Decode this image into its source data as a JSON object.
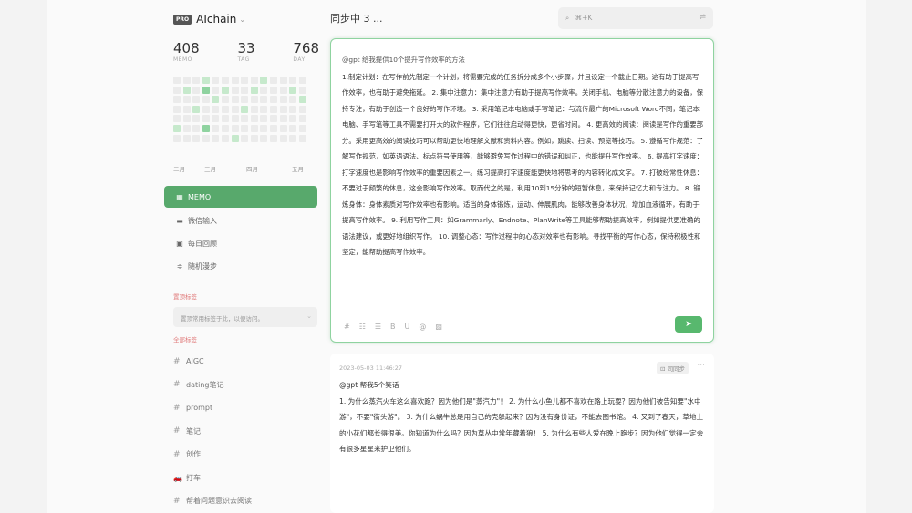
{
  "brand": {
    "badge": "PRO",
    "name": "AIchain"
  },
  "stats": [
    {
      "value": "408",
      "label": "MEMO"
    },
    {
      "value": "33",
      "label": "TAG"
    },
    {
      "value": "768",
      "label": "DAY"
    }
  ],
  "heatmap_levels": [
    0,
    0,
    0,
    1,
    0,
    0,
    0,
    0,
    0,
    1,
    0,
    0,
    0,
    0,
    0,
    1,
    0,
    2,
    0,
    1,
    0,
    0,
    1,
    0,
    0,
    0,
    1,
    0,
    0,
    0,
    0,
    0,
    1,
    0,
    0,
    0,
    0,
    0,
    0,
    0,
    0,
    1,
    0,
    0,
    1,
    0,
    0,
    0,
    0,
    1,
    0,
    0,
    0,
    0,
    0,
    0,
    0,
    0,
    0,
    0,
    0,
    0,
    0,
    0,
    0,
    0,
    0,
    0,
    0,
    0,
    1,
    0,
    0,
    2,
    0,
    0,
    0,
    0,
    0,
    0,
    0,
    0,
    0,
    0,
    0,
    0,
    0,
    0,
    0,
    0,
    1,
    0,
    0,
    0,
    0,
    0,
    0,
    0
  ],
  "months": [
    "二月",
    "三月",
    "四月",
    "五月"
  ],
  "nav": [
    {
      "icon": "grid-icon",
      "glyph": "▦",
      "label": "MEMO",
      "active": true
    },
    {
      "icon": "chat-icon",
      "glyph": "▬",
      "label": "微信输入",
      "active": false
    },
    {
      "icon": "calendar-icon",
      "glyph": "▣",
      "label": "每日回顾",
      "active": false
    },
    {
      "icon": "shuffle-icon",
      "glyph": "≑",
      "label": "随机漫步",
      "active": false
    }
  ],
  "pinned_label": "置顶标签",
  "pinned_placeholder": "置顶常用标签于此，以便访问。",
  "all_tags_label": "全部标签",
  "tags": [
    {
      "icon": "hash-icon",
      "glyph": "#",
      "label": "AIGC"
    },
    {
      "icon": "hash-icon",
      "glyph": "#",
      "label": "dating笔记"
    },
    {
      "icon": "hash-icon",
      "glyph": "#",
      "label": "prompt"
    },
    {
      "icon": "hash-icon",
      "glyph": "#",
      "label": "笔记"
    },
    {
      "icon": "hash-icon",
      "glyph": "#",
      "label": "创作"
    },
    {
      "icon": "car-icon",
      "glyph": "🚗",
      "label": "打车"
    },
    {
      "icon": "hash-icon",
      "glyph": "#",
      "label": "帮着问题意识去阅读"
    }
  ],
  "main": {
    "title": "同步中 3 ...",
    "search_placeholder": "⌘+K"
  },
  "editor": {
    "first_line": "@gpt 给我提供10个提升写作效率的方法",
    "body": "1.制定计划：在写作前先制定一个计划，将需要完成的任务拆分成多个小步骤，并且设定一个截止日期。这有助于提高写作效率，也有助于避免拖延。 2. 集中注意力：集中注意力有助于提高写作效率。关闭手机、电脑等分散注意力的设备，保持专注，有助于创造一个良好的写作环境。 3. 采用笔记本电脑或手写笔记：与流传最广的Microsoft Word不同，笔记本电脑、手写笔等工具不需要打开大的软件程序，它们往往启动得更快，更省时间。 4. 更高效的阅读：阅读是写作的重要部分。采用更高效的阅读技巧可以帮助更快地理解文献和资料内容。例如，跳读、扫读、预览等技巧。 5. 遵循写作规范：了解写作规范，如英语语法、标点符号使用等，能够避免写作过程中的错误和纠正，也能提升写作效率。 6. 提高打字速度：打字速度也是影响写作效率的重要因素之一。练习提高打字速度能更快地将思考的内容转化成文字。 7. 打破经常性休息：不要过于频繁的休息，这会影响写作效率。取而代之的是，利用10到15分钟的短暂休息，来保持记忆力和专注力。 8. 锻炼身体：身体素质对写作效率也有影响。适当的身体锻炼，运动、伸展肌肉，能够改善身体状况，增加血液循环，有助于提高写作效率。 9. 利用写作工具：如Grammarly、Endnote、PlanWrite等工具能够帮助提高效率，例如提供更准确的语法建议，或更好地组织写作。 10. 调整心态：写作过程中的心态对效率也有影响。寻找平衡的写作心态，保持积极性和坚定，能帮助提高写作效率。"
  },
  "memo": {
    "date": "2023-05-03 11:46:27",
    "badge": "同同步",
    "first_line": "@gpt 帮我5个笑话",
    "body": "1. 为什么蒸汽火车这么喜欢跑？因为他们是\"蒸汽力\"！ 2. 为什么小鱼儿都不喜欢在路上玩耍？因为他们被告知要\"水中游\"，不要\"街头游\"。 3. 为什么蜗牛总是用自己的壳躲起来？因为没有身份证，不能去图书馆。 4. 又到了春天，草地上的小花们都长得很美。你知道为什么吗？因为草丛中常年藏着狼！ 5. 为什么有些人爱在晚上跑步？因为他们觉得一定会有很多星星来护卫他们。"
  },
  "colors": {
    "accent": "#58a96c",
    "send": "#58b86e"
  }
}
